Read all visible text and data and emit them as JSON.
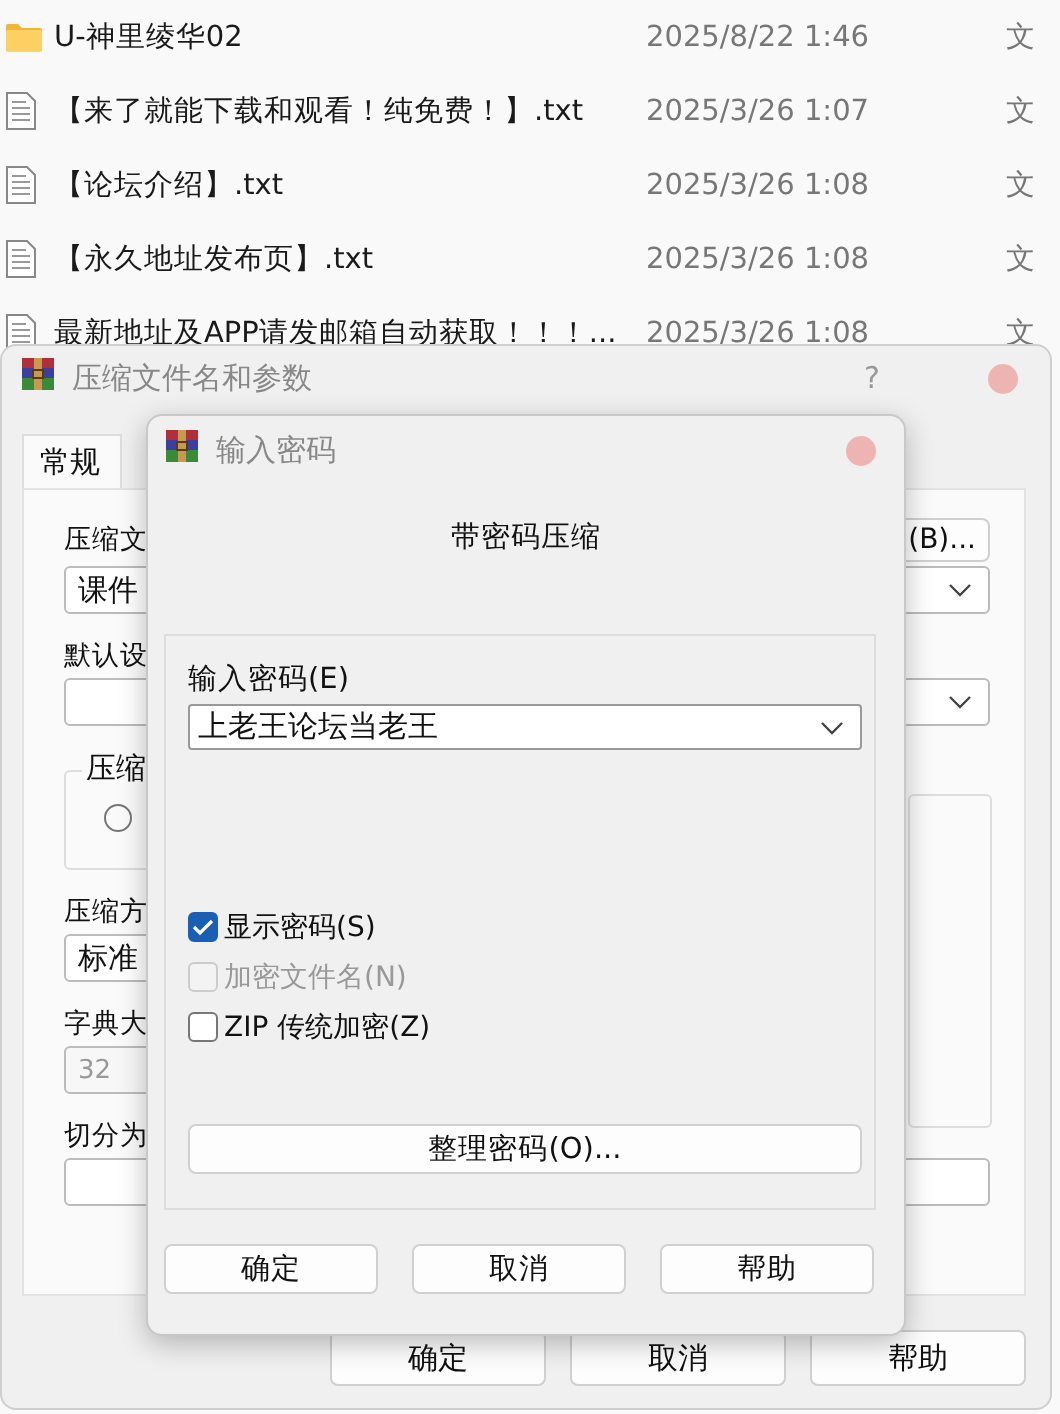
{
  "file_list": [
    {
      "kind": "folder",
      "name": "U-神里绫华02",
      "modified": "2025/8/22 1:46",
      "type": "文"
    },
    {
      "kind": "text",
      "name": "【来了就能下载和观看！纯免费！】.txt",
      "modified": "2025/3/26 1:07",
      "type": "文"
    },
    {
      "kind": "text",
      "name": "【论坛介绍】.txt",
      "modified": "2025/3/26 1:08",
      "type": "文"
    },
    {
      "kind": "text",
      "name": "【永久地址发布页】.txt",
      "modified": "2025/3/26 1:08",
      "type": "文"
    },
    {
      "kind": "text",
      "name": "最新地址及APP请发邮箱自动获取！！！...",
      "modified": "2025/3/26 1:08",
      "type": "文"
    }
  ],
  "archive_dialog": {
    "title": "压缩文件名和参数",
    "help": "?",
    "tabs": [
      {
        "label": "常规",
        "selected": true
      }
    ],
    "archive_name_label": "压缩文",
    "browse_button": "(B)...",
    "archive_name": "课件",
    "profile_label": "默认设",
    "format_group_label": "压缩",
    "format_radio": {
      "selected": false
    },
    "method_label": "压缩方",
    "method": "标准",
    "dictionary_label": "字典大",
    "dictionary": "32",
    "split_label": "切分为",
    "buttons": [
      "确定",
      "取消",
      "帮助"
    ]
  },
  "password_dialog": {
    "title": "输入密码",
    "heading": "带密码压缩",
    "password_label": "输入密码(E)",
    "password": "上老王论坛当老王",
    "options": [
      {
        "label": "显示密码(S)",
        "checked": true,
        "disabled": false
      },
      {
        "label": "加密文件名(N)",
        "checked": false,
        "disabled": true
      },
      {
        "label": "ZIP 传统加密(Z)",
        "checked": false,
        "disabled": false
      }
    ],
    "organize_button": "整理密码(O)...",
    "buttons": [
      "确定",
      "取消",
      "帮助"
    ]
  }
}
